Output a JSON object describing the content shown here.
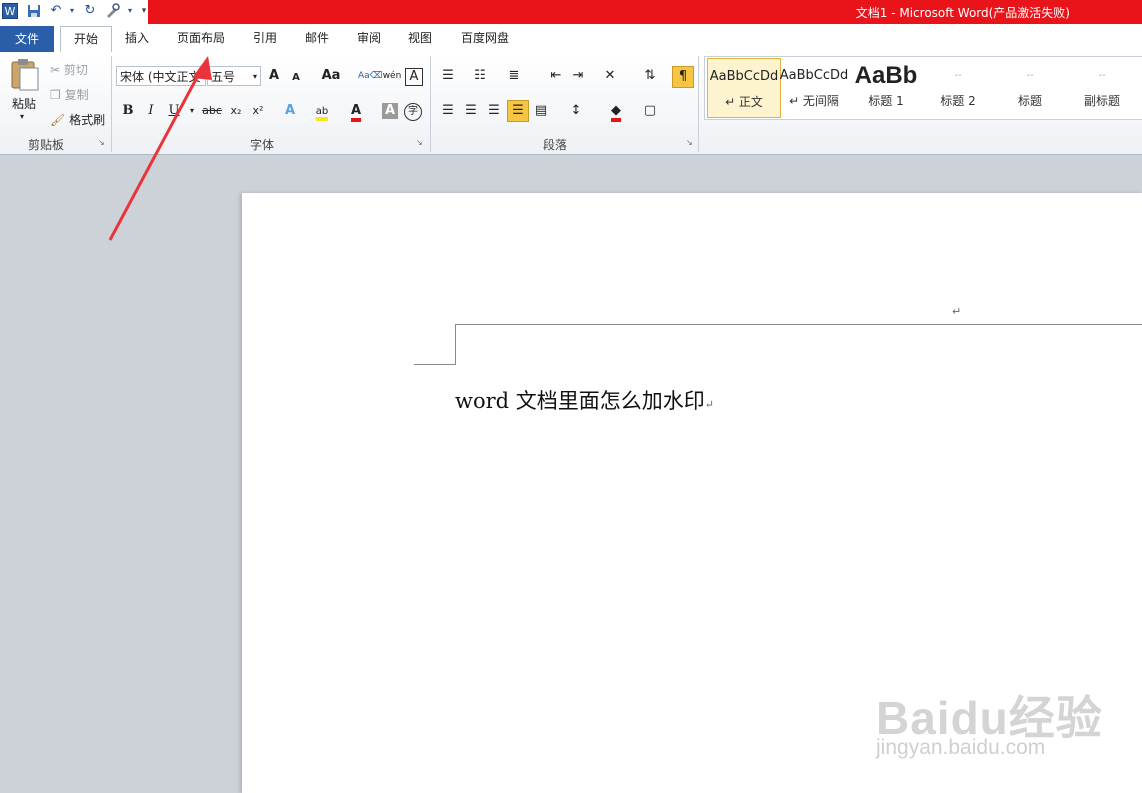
{
  "window": {
    "title": "文档1 - Microsoft Word(产品激活失败)"
  },
  "tabs": {
    "file": "文件",
    "home": "开始",
    "insert": "插入",
    "page_layout": "页面布局",
    "references": "引用",
    "mailings": "邮件",
    "review": "审阅",
    "view": "视图",
    "baidu_disk": "百度网盘"
  },
  "clipboard": {
    "paste": "粘贴",
    "cut": "剪切",
    "copy": "复制",
    "format_painter": "格式刷",
    "group": "剪贴板"
  },
  "font": {
    "name": "宋体 (中文正文",
    "size": "五号",
    "group": "字体",
    "bold": "B",
    "italic": "I",
    "underline": "U",
    "strike": "abc",
    "sub": "x₂",
    "sup": "x²",
    "grow": "A",
    "shrink": "A",
    "case": "Aa",
    "color_a": "A",
    "char_shade": "A",
    "phonetic": "wén",
    "border_a": "A",
    "circle": "字"
  },
  "paragraph": {
    "group": "段落"
  },
  "styles": [
    {
      "preview": "AaBbCcDd",
      "name": "↵ 正文"
    },
    {
      "preview": "AaBbCcDd",
      "name": "↵ 无间隔"
    },
    {
      "preview": "AaBb",
      "name": "标题 1"
    },
    {
      "preview": "--",
      "name": "标题 2"
    },
    {
      "preview": "--",
      "name": "标题"
    },
    {
      "preview": "--",
      "name": "副标题"
    }
  ],
  "document": {
    "line1": "word 文档里面怎么加水印",
    "para_mark": "↵"
  },
  "watermark": {
    "logo": "Baidu经验",
    "url": "jingyan.baidu.com"
  },
  "colors": {
    "title_red": "#e8141a",
    "file_tab": "#2a5ea8",
    "arrow": "#e8343a",
    "highlight": "#f6c544"
  }
}
